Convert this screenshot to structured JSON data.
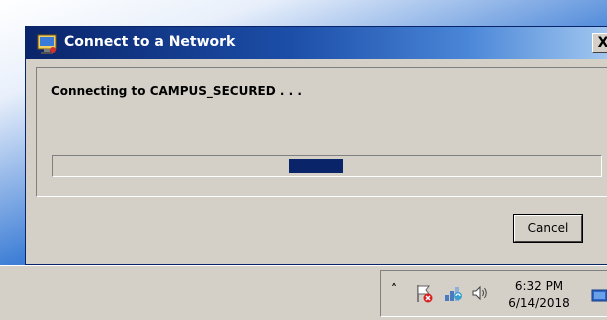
{
  "dialog": {
    "title": "Connect to a Network",
    "close_label": "X",
    "status_message": "Connecting to CAMPUS_SECURED . . .",
    "cancel_label": "Cancel",
    "progress_state": "indeterminate"
  },
  "taskbar": {
    "tray": {
      "overflow_chevron": "˄˅",
      "icons": [
        "action-center-flag-icon",
        "network-icon",
        "volume-icon",
        "show-desktop-icon"
      ],
      "clock_time": "6:32 PM",
      "clock_date": "6/14/2018"
    }
  },
  "colors": {
    "titlebar_start": "#0a246a",
    "titlebar_end": "#a6caf0",
    "window_face": "#d4d0c8",
    "progress_fill": "#0a246a"
  }
}
